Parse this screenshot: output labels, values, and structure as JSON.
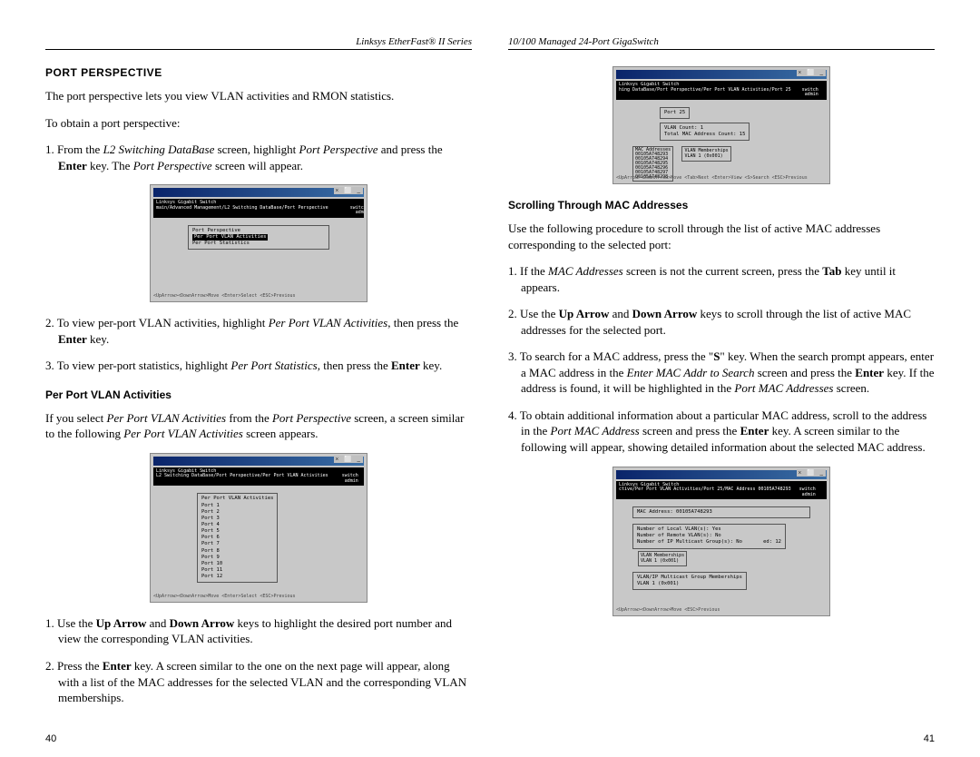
{
  "left": {
    "header": "Linksys EtherFast® II Series",
    "section_head": "PORT PERSPECTIVE",
    "intro": "The port perspective lets you view VLAN activities and RMON statistics.",
    "obtain": "To obtain a port perspective:",
    "step1_a": "1. From the ",
    "step1_b": "L2 Switching DataBase",
    "step1_c": " screen, highlight ",
    "step1_d": "Port Perspective",
    "step1_e": " and press the ",
    "step1_f": "Enter",
    "step1_g": " key. The ",
    "step1_h": "Port Perspective",
    "step1_i": " screen will appear.",
    "step2_a": "2. To view per-port VLAN activities, highlight ",
    "step2_b": "Per Port VLAN Activities",
    "step2_c": ", then press the ",
    "step2_d": "Enter",
    "step2_e": " key.",
    "step3_a": "3. To view per-port statistics, highlight ",
    "step3_b": "Per Port Statistics",
    "step3_c": ", then press the ",
    "step3_d": "Enter",
    "step3_e": " key.",
    "sub_head": "Per Port VLAN Activities",
    "vlan_a": "If you select ",
    "vlan_b": "Per Port VLAN Activities",
    "vlan_c": " from the ",
    "vlan_d": "Port Perspective",
    "vlan_e": " screen, a screen similar to the following ",
    "vlan_f": "Per Port VLAN Activities",
    "vlan_g": " screen appears.",
    "vstep1_a": "1. Use the ",
    "vstep1_b": "Up Arrow",
    "vstep1_c": " and ",
    "vstep1_d": "Down Arrow",
    "vstep1_e": " keys to highlight the desired port number and view the corresponding VLAN activities.",
    "vstep2_a": "2. Press the ",
    "vstep2_b": "Enter",
    "vstep2_c": " key. A screen similar to the one on the next page will appear, along with a list of the MAC addresses for the selected VLAN and the corresponding VLAN memberships.",
    "page_num": "40",
    "shot1_top": "Linksys Gigabit Switch\nmain/Advanced Management/L2 Switching DataBase/Port Perspective        switch\n                                                                         admin",
    "shot1_body_title": "Port Perspective",
    "shot1_row1": "Per Port VLAN Activities",
    "shot1_row2": "Per Port Statistics",
    "shot1_foot": "<UpArrow><DownArrow>Move  <Enter>Select                        <ESC>Previous",
    "shot2_top": "Linksys Gigabit Switch\nL2 Switching DataBase/Port Perspective/Per Port VLAN Activities     switch\n                                                                     admin",
    "shot2_title": "Per Port VLAN Activities",
    "shot2_ports": "Port 1\nPort 2\nPort 3\nPort 4\nPort 5\nPort 6\nPort 7\nPort 8\nPort 9\nPort 10\nPort 11\nPort 12",
    "shot2_foot": "<UpArrow><DownArrow>Move  <Enter>Select                        <ESC>Previous"
  },
  "right": {
    "header": "10/100 Managed 24-Port GigaSwitch",
    "sub_head": "Scrolling Through MAC Addresses",
    "intro": "Use the following procedure to scroll through the list of active MAC addresses corresponding to the selected port:",
    "step1_a": "1. If the ",
    "step1_b": "MAC Addresses",
    "step1_c": " screen is not the current screen, press the ",
    "step1_d": "Tab",
    "step1_e": " key until it appears.",
    "step2_a": "2. Use the ",
    "step2_b": "Up Arrow",
    "step2_c": " and ",
    "step2_d": "Down Arrow",
    "step2_e": " keys to scroll through the list of active MAC addresses for the selected port.",
    "step3_a": "3. To search for a MAC address, press the \"",
    "step3_b": "S",
    "step3_c": "\" key. When the search prompt appears, enter a MAC address in the ",
    "step3_d": "Enter MAC Addr to Search",
    "step3_e": " screen and press the ",
    "step3_f": "Enter",
    "step3_g": " key. If the address is found, it will be highlighted in the ",
    "step3_h": "Port MAC Addresses",
    "step3_i": " screen.",
    "step4_a": "4. To obtain additional information about a particular MAC address, scroll to the address in the ",
    "step4_b": "Port MAC Address",
    "step4_c": " screen and press the ",
    "step4_d": "Enter",
    "step4_e": " key. A screen similar to the following will appear, showing detailed information about the selected MAC address.",
    "page_num": "41",
    "shot3_top": "Linksys Gigabit Switch\nhing DataBase/Port Perspective/Per Port VLAN Activities/Port 25    switch\n                                                                    admin",
    "shot3_port": "Port 25",
    "shot3_counts": "VLAN Count: 1\nTotal MAC Address Count: 15",
    "shot3_mac_title": "MAC Addresses",
    "shot3_macs": "00105A748293\n00105A748294\n00105A748295\n00105A748296\n00105A748297\n00105A748298",
    "shot3_vlan_title": "VLAN Memberships",
    "shot3_vlan": "VLAN 1 (0x001)",
    "shot3_foot": "<UpArrow><DownArrow>Move <Tab>Next <Enter>View <S>Search          <ESC>Previous",
    "shot4_top": "Linksys Gigabit Switch\nctive/Per Port VLAN Activities/Port 25/MAC Address 00105A748293   switch\n                                                                   admin",
    "shot4_title": "MAC Address: 00105A748293",
    "shot4_info": "Number of Local VLAN(s): Yes\nNumber of Remote VLAN(s): No\nNumber of IP Multicast Group(s): No       ed: 12",
    "shot4_vlan_title": "VLAN Memberships",
    "shot4_vlan": "VLAN 1 (0x001)",
    "shot4_group_title": "VLAN/IP Multicast Group Memberships",
    "shot4_group": "VLAN 1 (0x001)",
    "shot4_foot": "<UpArrow><DownArrow>Move                                      <ESC>Previous"
  }
}
